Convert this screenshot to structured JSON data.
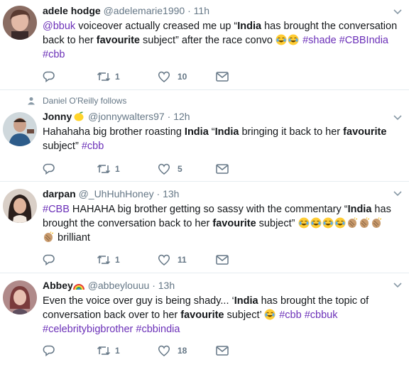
{
  "tweets": [
    {
      "name": "adele hodge",
      "handle": "@adelemarie1990",
      "dot": "·",
      "time": "11h",
      "lines": [
        {
          "mention": "@bbuk",
          "t1": " voiceover actually creased me up “",
          "b1": "India",
          "t2": " has brought the conversation"
        },
        {
          "t1": "back to her ",
          "b1": "favourite",
          "t2": " subject” after the race convo ",
          "tag1": "#shade",
          "tag2": "#CBBIndia"
        },
        {
          "tag1": "#cbb"
        }
      ],
      "retweets": "1",
      "likes": "10"
    },
    {
      "social": "Daniel O'Reilly follows",
      "name": "Jonny",
      "handle": "@jonnywalters97",
      "dot": "·",
      "time": "12h",
      "lines": [
        {
          "t1": "Hahahaha big brother roasting ",
          "b1": "India",
          "t2": " “",
          "b2": "India",
          "t3": " bringing it back to her ",
          "b3": "favourite"
        },
        {
          "t1": "subject” ",
          "tag1": "#cbb"
        }
      ],
      "retweets": "1",
      "likes": "5"
    },
    {
      "name": "darpan",
      "handle": "@_UhHuhHoney",
      "dot": "·",
      "time": "13h",
      "lines": [
        {
          "tag1": "#CBB",
          "t1": " HAHAHA big brother getting so sassy with the commentary “",
          "b1": "India",
          "t2": " has"
        },
        {
          "t1": "brought the conversation back to her ",
          "b1": "favourite",
          "t2": " subject” "
        },
        {
          "t1": " brilliant"
        }
      ],
      "retweets": "1",
      "likes": "11"
    },
    {
      "name": "Abbey",
      "handle": "@abbeylouuu",
      "dot": "·",
      "time": "13h",
      "lines": [
        {
          "t1": "Even the voice over guy is being shady... ‘",
          "b1": "India",
          "t2": " has brought the topic of"
        },
        {
          "t1": "conversation back over to her ",
          "b1": "favourite",
          "t2": " subject’ ",
          "tag1": "#cbb",
          "tag2": "#cbbuk"
        },
        {
          "tag1": "#celebritybigbrother",
          "tag2": "#cbbindia"
        }
      ],
      "retweets": "1",
      "likes": "18"
    }
  ],
  "icons": {
    "reply": "reply-icon",
    "retweet": "retweet-icon",
    "like": "heart-icon",
    "dm": "envelope-icon",
    "caret": "chevron-down-icon",
    "follows": "person-icon"
  },
  "colors": {
    "hashtag": "#6b30b8",
    "meta": "#657786",
    "divider": "#e6ecf0"
  }
}
